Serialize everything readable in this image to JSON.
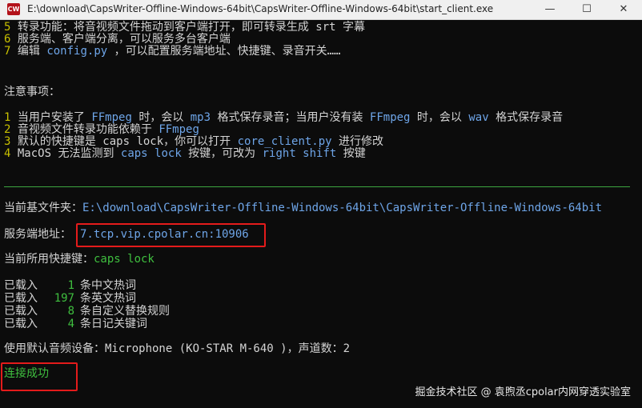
{
  "window": {
    "app_icon_label": "CW",
    "title": "E:\\download\\CapsWriter-Offline-Windows-64bit\\CapsWriter-Offline-Windows-64bit\\start_client.exe",
    "minimize_glyph": "—",
    "maximize_glyph": "☐",
    "close_glyph": "✕"
  },
  "usage_items": [
    {
      "num": "5",
      "parts": [
        {
          "t": "转录功能：将音视频文件拖动到客户端打开，即可转录生成 srt 字幕",
          "c": ""
        }
      ]
    },
    {
      "num": "6",
      "parts": [
        {
          "t": "服务端、客户端分离，可以服务多台客户端",
          "c": ""
        }
      ]
    },
    {
      "num": "7",
      "parts": [
        {
          "t": "编辑 ",
          "c": ""
        },
        {
          "t": "config.py",
          "c": "hl"
        },
        {
          "t": " ，可以配置服务端地址、快捷键、录音开关……",
          "c": ""
        }
      ]
    }
  ],
  "notes_heading": "注意事项：",
  "notes_items": [
    {
      "num": "1",
      "parts": [
        {
          "t": "当用户安装了 ",
          "c": ""
        },
        {
          "t": "FFmpeg",
          "c": "hl"
        },
        {
          "t": " 时，会以 ",
          "c": ""
        },
        {
          "t": "mp3",
          "c": "hl"
        },
        {
          "t": " 格式保存录音；当用户没有装 ",
          "c": ""
        },
        {
          "t": "FFmpeg",
          "c": "hl"
        },
        {
          "t": " 时，会以 ",
          "c": ""
        },
        {
          "t": "wav",
          "c": "hl"
        },
        {
          "t": " 格式保存录音",
          "c": ""
        }
      ]
    },
    {
      "num": "2",
      "parts": [
        {
          "t": "音视频文件转录功能依赖于 ",
          "c": ""
        },
        {
          "t": "FFmpeg",
          "c": "hl"
        }
      ]
    },
    {
      "num": "3",
      "parts": [
        {
          "t": "默认的快捷键是 caps lock，你可以打开 ",
          "c": ""
        },
        {
          "t": "core_client.py",
          "c": "hl"
        },
        {
          "t": " 进行修改",
          "c": ""
        }
      ]
    },
    {
      "num": "4",
      "parts": [
        {
          "t": "MacOS 无法监测到 ",
          "c": ""
        },
        {
          "t": "caps lock",
          "c": "hl"
        },
        {
          "t": " 按键，可改为 ",
          "c": ""
        },
        {
          "t": "right shift",
          "c": "hl"
        },
        {
          "t": " 按键",
          "c": ""
        }
      ]
    }
  ],
  "status": {
    "base_dir_label": "当前基文件夹：",
    "base_dir_value": "E:\\download\\CapsWriter-Offline-Windows-64bit\\CapsWriter-Offline-Windows-64bit",
    "server_label": "服务端地址：",
    "server_value": "7.tcp.vip.cpolar.cn:10906",
    "shortcut_label": "当前所用快捷键：",
    "shortcut_value": "caps lock"
  },
  "loaded": [
    {
      "label": "已载入",
      "count": "1",
      "desc": "条中文热词"
    },
    {
      "label": "已载入",
      "count": "197",
      "desc": "条英文热词"
    },
    {
      "label": "已载入",
      "count": "8",
      "desc": "条自定义替换规则"
    },
    {
      "label": "已载入",
      "count": "4",
      "desc": "条日记关键词"
    }
  ],
  "audio_device": "使用默认音频设备：Microphone (KO-STAR M-640 )，声道数：2",
  "connected": "连接成功",
  "watermark": "掘金技术社区 @ 袁煦丞cpolar内网穿透实验室",
  "colors": {
    "highlight_box": "#e41b1b",
    "link_blue": "#6ea5e8",
    "number_yellow": "#c8c000",
    "success_green": "#3fbf3f"
  }
}
